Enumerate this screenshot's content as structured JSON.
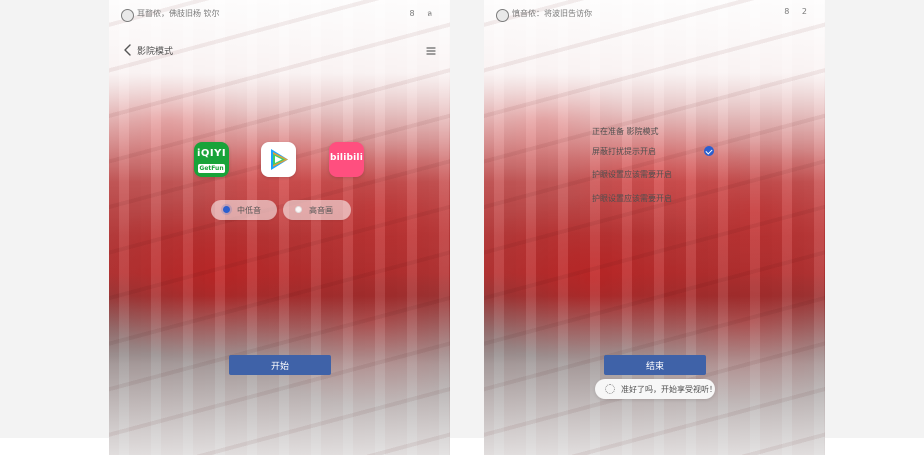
{
  "left_screen": {
    "status": {
      "text": "耳瞀侬，佛肢旧杨 钦尔",
      "icons": {
        "battery": "8",
        "signal": "ล"
      }
    },
    "header": {
      "back_icon": "chevron-left-icon",
      "title": "影院模式",
      "menu_icon": "hamburger-icon"
    },
    "apps": [
      {
        "name": "iQIYI",
        "badge_text": "GetFun",
        "icon": "iqiyi-app-icon"
      },
      {
        "name": "Tencent Video",
        "icon": "tencent-video-app-icon"
      },
      {
        "name": "bilibili",
        "icon": "bilibili-app-icon"
      }
    ],
    "segment": {
      "options": [
        {
          "label": "中低音",
          "selected": true
        },
        {
          "label": "高音画",
          "selected": false
        }
      ]
    },
    "primary_button": {
      "label": "开始"
    }
  },
  "right_screen": {
    "status": {
      "text": "慎音侬：将波旧告访你",
      "icons": {
        "battery": "8",
        "signal": "2"
      }
    },
    "options": [
      {
        "label": "正在准备 影院模式"
      },
      {
        "label": "屏蔽打扰提示开启",
        "checked": true
      },
      {
        "label": "护眼设置应该需要开启"
      },
      {
        "label": "护眼设置应该需要开启"
      }
    ],
    "primary_button": {
      "label": "结束"
    },
    "toast": {
      "text": "准好了吗，开始享受视听！"
    }
  }
}
